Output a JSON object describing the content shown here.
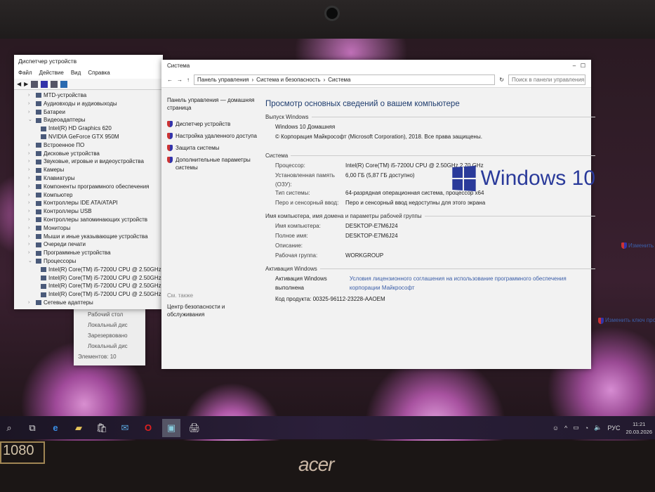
{
  "device_manager": {
    "title": "Диспетчер устройств",
    "menu": [
      "Файл",
      "Действие",
      "Вид",
      "Справка"
    ],
    "tree": [
      {
        "label": "MTD-устройства",
        "level": 0,
        "expanded": false
      },
      {
        "label": "Аудиовходы и аудиовыходы",
        "level": 0,
        "expanded": false
      },
      {
        "label": "Батареи",
        "level": 0,
        "expanded": false
      },
      {
        "label": "Видеоадаптеры",
        "level": 0,
        "expanded": true
      },
      {
        "label": "Intel(R) HD Graphics 620",
        "level": 1
      },
      {
        "label": "NVIDIA GeForce GTX 950M",
        "level": 1
      },
      {
        "label": "Встроенное ПО",
        "level": 0,
        "expanded": false
      },
      {
        "label": "Дисковые устройства",
        "level": 0,
        "expanded": false
      },
      {
        "label": "Звуковые, игровые и видеоустройства",
        "level": 0,
        "expanded": false
      },
      {
        "label": "Камеры",
        "level": 0,
        "expanded": false
      },
      {
        "label": "Клавиатуры",
        "level": 0,
        "expanded": false
      },
      {
        "label": "Компоненты программного обеспечения",
        "level": 0,
        "expanded": false
      },
      {
        "label": "Компьютер",
        "level": 0,
        "expanded": false
      },
      {
        "label": "Контроллеры IDE ATA/ATAPI",
        "level": 0,
        "expanded": false
      },
      {
        "label": "Контроллеры USB",
        "level": 0,
        "expanded": false
      },
      {
        "label": "Контроллеры запоминающих устройств",
        "level": 0,
        "expanded": false
      },
      {
        "label": "Мониторы",
        "level": 0,
        "expanded": false
      },
      {
        "label": "Мыши и иные указывающие устройства",
        "level": 0,
        "expanded": false
      },
      {
        "label": "Очереди печати",
        "level": 0,
        "expanded": false
      },
      {
        "label": "Программные устройства",
        "level": 0,
        "expanded": false
      },
      {
        "label": "Процессоры",
        "level": 0,
        "expanded": true
      },
      {
        "label": "Intel(R) Core(TM) i5-7200U CPU @ 2.50GHz",
        "level": 1
      },
      {
        "label": "Intel(R) Core(TM) i5-7200U CPU @ 2.50GHz",
        "level": 1
      },
      {
        "label": "Intel(R) Core(TM) i5-7200U CPU @ 2.50GHz",
        "level": 1
      },
      {
        "label": "Intel(R) Core(TM) i5-7200U CPU @ 2.50GHz",
        "level": 1
      },
      {
        "label": "Сетевые адаптеры",
        "level": 0,
        "expanded": false
      }
    ]
  },
  "explorer": {
    "items": [
      "Рабочий стол",
      "Локальный дис",
      "Зарезервовано",
      "Локальный дис"
    ],
    "status": "Элементов: 10"
  },
  "system": {
    "title": "Система",
    "breadcrumb": [
      "Панель управления",
      "Система и безопасность",
      "Система"
    ],
    "search_placeholder": "Поиск в панели управления",
    "sidebar": {
      "home": "Панель управления — домашняя страница",
      "links": [
        "Диспетчер устройств",
        "Настройка удаленного доступа",
        "Защита системы",
        "Дополнительные параметры системы"
      ],
      "see_also": "См. также",
      "security_center": "Центр безопасности и обслуживания"
    },
    "heading": "Просмотр основных сведений о вашем компьютере",
    "edition_section": "Выпуск Windows",
    "edition": "Windows 10 Домашняя",
    "copyright": "© Корпорация Майкрософт (Microsoft Corporation), 2018. Все права защищены.",
    "logo_text": "Windows 10",
    "system_section": "Система",
    "system_rows": [
      {
        "k": "Процессор:",
        "v": "Intel(R) Core(TM) i5-7200U CPU @ 2.50GHz   2.70 GHz"
      },
      {
        "k": "Установленная память (ОЗУ):",
        "v": "6,00 ГБ (5,87 ГБ доступно)"
      },
      {
        "k": "Тип системы:",
        "v": "64-разрядная операционная система, процессор x64"
      },
      {
        "k": "Перо и сенсорный ввод:",
        "v": "Перо и сенсорный ввод недоступны для этого экрана"
      }
    ],
    "name_section": "Имя компьютера, имя домена и параметры рабочей группы",
    "name_rows": [
      {
        "k": "Имя компьютера:",
        "v": "DESKTOP-E7M6J24"
      },
      {
        "k": "Полное имя:",
        "v": "DESKTOP-E7M6J24"
      },
      {
        "k": "Описание:",
        "v": ""
      },
      {
        "k": "Рабочая группа:",
        "v": "WORKGROUP"
      }
    ],
    "change_params": "Изменить параметры",
    "activation_section": "Активация Windows",
    "activation_status": "Активация Windows выполнена",
    "license_link": "Условия лицензионного соглашения на использование программного обеспечения корпорации Майкрософт",
    "product_key": "Код продукта: 00325-96112-23228-AAOEM",
    "change_key": "Изменить ключ продукта"
  },
  "taskbar": {
    "lang": "РУС",
    "time": "11:21",
    "date": "20.03.2026"
  },
  "hardware": {
    "brand": "acer",
    "sticker": "1080"
  }
}
